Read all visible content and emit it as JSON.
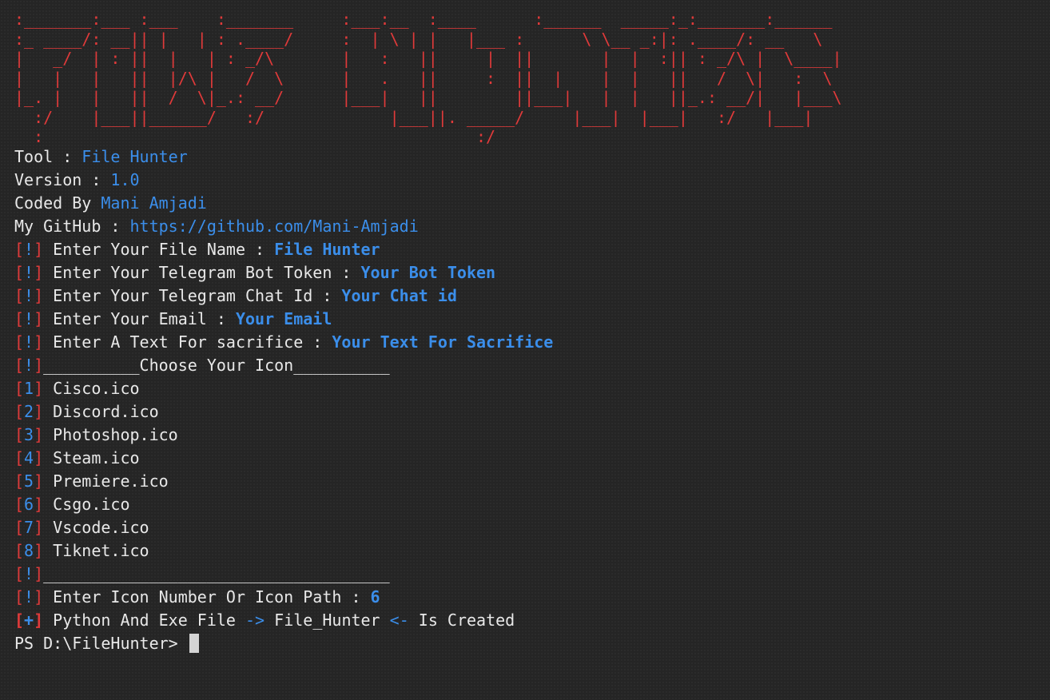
{
  "banner": {
    "art": ":_______:___ :___    :_______     :___:__  :____      :______  _____:_:_______:______\n:_ ____/: __|| |   | : .____/     :  | \\ | |   |___ :      \\ \\__ _:|: .____/: __   \\\n|   _/  | : ||  |   | : _/\\       |   :   ||     |  ||       |  |  :|| : _/\\ |  \\____|\n|   |   |   ||  |/\\ |   /  \\      |   .   ||     :  ||  |    |  |   ||   /  \\|   :  \\\n|_. |   |   ||  /  \\|_.: __/      |___|   ||        ||___|   |  |   ||_.: __/|   |___\\\n  :/    |___||______/   :/             |___||. _____/     |___|  |___|   :/   |___|\n  :                                             :/",
    "color": "#e03a3a"
  },
  "info": {
    "tool_label": "Tool : ",
    "tool_value": "File Hunter",
    "version_label": "Version : ",
    "version_value": "1.0",
    "coded_label": "Coded By ",
    "coded_value": "Mani Amjadi",
    "github_label": "My GitHub : ",
    "github_value": "https://github.com/Mani-Amjadi"
  },
  "prompts": {
    "marker_open": "[",
    "marker_bang": "!",
    "marker_close": "]",
    "file_name_label": " Enter Your File Name : ",
    "file_name_value": "File Hunter",
    "bot_token_label": " Enter Your Telegram Bot Token : ",
    "bot_token_value": "Your Bot Token",
    "chat_id_label": " Enter Your Telegram Chat Id : ",
    "chat_id_value": "Your Chat id",
    "email_label": " Enter Your Email : ",
    "email_value": "Your Email",
    "sacrifice_label": " Enter A Text For sacrifice : ",
    "sacrifice_value": "Your Text For Sacrifice",
    "icon_header": "__________Choose Your Icon__________",
    "icon_footer": "____________________________________",
    "icon_number_label": " Enter Icon Number Or Icon Path : ",
    "icon_number_value": "6"
  },
  "icons": [
    {
      "num": "1",
      "name": " Cisco.ico"
    },
    {
      "num": "2",
      "name": " Discord.ico"
    },
    {
      "num": "3",
      "name": " Photoshop.ico"
    },
    {
      "num": "4",
      "name": " Steam.ico"
    },
    {
      "num": "5",
      "name": " Premiere.ico"
    },
    {
      "num": "6",
      "name": " Csgo.ico"
    },
    {
      "num": "7",
      "name": " Vscode.ico"
    },
    {
      "num": "8",
      "name": " Tiknet.ico"
    }
  ],
  "result": {
    "marker_plus": "+",
    "text_before": " Python And Exe File ",
    "arrow_right": "->",
    "file_name": " File_Hunter ",
    "arrow_left": "<-",
    "text_after": " Is Created"
  },
  "shell": {
    "prompt": "PS D:\\FileHunter> "
  },
  "colors": {
    "background": "#252525",
    "red": "#e03a3a",
    "blue": "#3b8eea",
    "text": "#dcdcdc"
  }
}
